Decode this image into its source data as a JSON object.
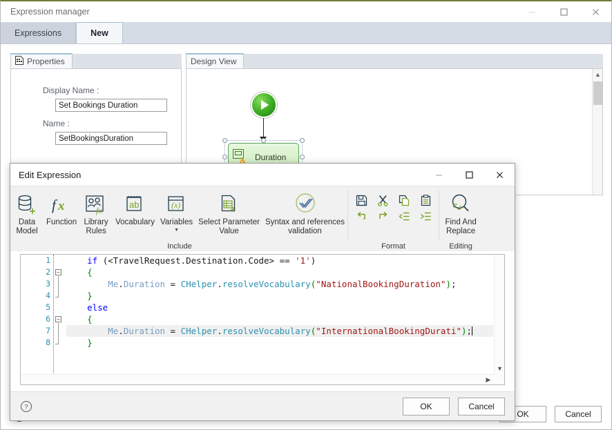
{
  "main_window": {
    "title": "Expression manager",
    "controls": {
      "minimize": "minimize-icon",
      "maximize": "maximize-icon",
      "close": "close-icon"
    },
    "tabs": [
      {
        "label": "Expressions",
        "active": false
      },
      {
        "label": "New",
        "active": true
      }
    ],
    "ok_label": "OK",
    "cancel_label": "Cancel"
  },
  "properties_panel": {
    "tab_label": "Properties",
    "tab_icon": "properties-grid-icon",
    "fields": [
      {
        "label": "Display Name :",
        "value": "Set Bookings Duration"
      },
      {
        "label": "Name :",
        "value": "SetBookingsDuration"
      }
    ]
  },
  "design_view": {
    "tab_label": "Design View",
    "start_node": "start-play-node",
    "activity": {
      "label": "Duration",
      "icon": "activity-window-icon",
      "badge": "warning-icon",
      "selected": true
    }
  },
  "dialog": {
    "title": "Edit Expression",
    "controls": {
      "minimize": "minimize-icon",
      "maximize": "maximize-icon",
      "close": "close-icon"
    },
    "ribbon": {
      "include_group": {
        "group_label": "Include",
        "items": [
          {
            "label_line1": "Data",
            "label_line2": "Model",
            "icon": "database-add-icon"
          },
          {
            "label_line1": "Function",
            "label_line2": "",
            "icon": "fx-icon"
          },
          {
            "label_line1": "Library",
            "label_line2": "Rules",
            "icon": "library-rules-icon"
          },
          {
            "label_line1": "Vocabulary",
            "label_line2": "",
            "icon": "vocabulary-ab-icon"
          },
          {
            "label_line1": "Variables",
            "label_line2": "",
            "icon": "variables-x-icon",
            "has_caret": true
          },
          {
            "label_line1": "Select Parameter",
            "label_line2": "Value",
            "icon": "select-parameter-value-icon"
          },
          {
            "label_line1": "Syntax and references",
            "label_line2": "validation",
            "icon": "syntax-validation-check-icon"
          }
        ]
      },
      "format_group": {
        "group_label": "Format",
        "row1": [
          {
            "icon": "save-icon"
          },
          {
            "icon": "cut-scissors-icon"
          },
          {
            "icon": "copy-icon"
          },
          {
            "icon": "paste-icon"
          }
        ],
        "row2": [
          {
            "icon": "undo-icon"
          },
          {
            "icon": "redo-icon"
          },
          {
            "icon": "outdent-icon"
          },
          {
            "icon": "indent-icon"
          }
        ]
      },
      "editing_group": {
        "group_label": "Editing",
        "items": [
          {
            "label_line1": "Find And",
            "label_line2": "Replace",
            "icon": "find-replace-icon"
          }
        ]
      }
    },
    "editor": {
      "line_numbers": [
        "1",
        "2",
        "3",
        "4",
        "5",
        "6",
        "7",
        "8"
      ],
      "lines": [
        {
          "n": 1,
          "text": "    if (<TravelRequest.Destination.Code> == '1')"
        },
        {
          "n": 2,
          "text": "    {"
        },
        {
          "n": 3,
          "text": "        Me.Duration = CHelper.resolveVocabulary(\"NationalBookingDuration\");"
        },
        {
          "n": 4,
          "text": "    }"
        },
        {
          "n": 5,
          "text": "    else"
        },
        {
          "n": 6,
          "text": "    {"
        },
        {
          "n": 7,
          "text": "        Me.Duration = CHelper.resolveVocabulary(\"InternationalBookingDurati\");"
        },
        {
          "n": 8,
          "text": "    }"
        }
      ],
      "active_line": 7,
      "fold_lines": [
        2,
        6
      ]
    },
    "help_icon": "help-question-icon",
    "ok_label": "OK",
    "cancel_label": "Cancel"
  },
  "colors": {
    "accent_green": "#6e7b33",
    "tabstrip": "#d6dce5",
    "ribbon_bg": "#f1f1f1",
    "icon_green": "#7ba428",
    "icon_dark": "#1f3a4d",
    "keyword_blue": "#0000ff",
    "string_red": "#a31515",
    "type_teal": "#2b91af",
    "paren_green": "#008000"
  }
}
